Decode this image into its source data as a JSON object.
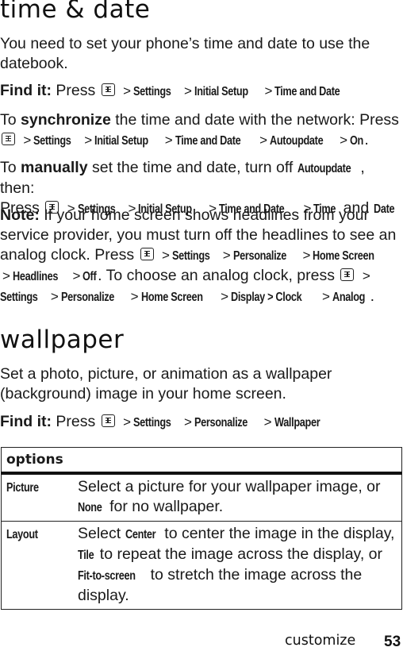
{
  "sections": {
    "time_date": {
      "title": "time & date",
      "intro": "You need to set your phone’s time and date to use the datebook.",
      "find_it": {
        "label": "Find it:",
        "press": "Press",
        "menu_key": "menu-key-icon",
        "path": [
          "Settings",
          "Initial Setup",
          "Time and Date"
        ]
      },
      "synchronize": {
        "prefix": "To",
        "keyword": "synchronize",
        "text": "the time and date with the network: Press",
        "path": [
          "Settings",
          "Initial Setup",
          "Time and Date",
          "Autoupdate",
          "On"
        ],
        "end": "."
      },
      "manually": {
        "prefix": "To",
        "keyword": "manually",
        "text": "set the time and date, turn off",
        "setting": "Autoupdate",
        "then": ", then:",
        "press": "Press",
        "path": [
          "Settings",
          "Initial Setup",
          "Time and Date",
          "Time"
        ],
        "and": "and",
        "last": "Date",
        "end": "."
      },
      "note": {
        "label": "Note:",
        "text1": "If your home screen shows headlines from your service provider, you must turn off the headlines to see an analog clock. Press",
        "path1": [
          "Settings",
          "Personalize",
          "Home Screen",
          "Headlines",
          "Off"
        ],
        "text2": ". To choose an analog clock, press",
        "path2": [
          "Settings",
          "Personalize",
          "Home Screen",
          "Display > Clock",
          "Analog"
        ],
        "end": "."
      }
    },
    "wallpaper": {
      "title": "wallpaper",
      "intro": "Set a photo, picture, or animation as a wallpaper (background) image in your home screen.",
      "find_it": {
        "label": "Find it:",
        "press": "Press",
        "path": [
          "Settings",
          "Personalize",
          "Wallpaper"
        ]
      },
      "options_table": {
        "header": "options",
        "rows": [
          {
            "name": "Picture",
            "desc_parts": [
              "Select a picture for your wallpaper image, or ",
              "None",
              " for no wallpaper."
            ]
          },
          {
            "name": "Layout",
            "desc_parts": [
              "Select ",
              "Center",
              " to center the image in the display, ",
              "Tile",
              " to repeat the image across the display, or ",
              "Fit-to-screen",
              " to stretch the image across the display."
            ]
          }
        ]
      }
    }
  },
  "footer": {
    "section_label": "customize",
    "page_number": "53"
  },
  "separator": ">"
}
